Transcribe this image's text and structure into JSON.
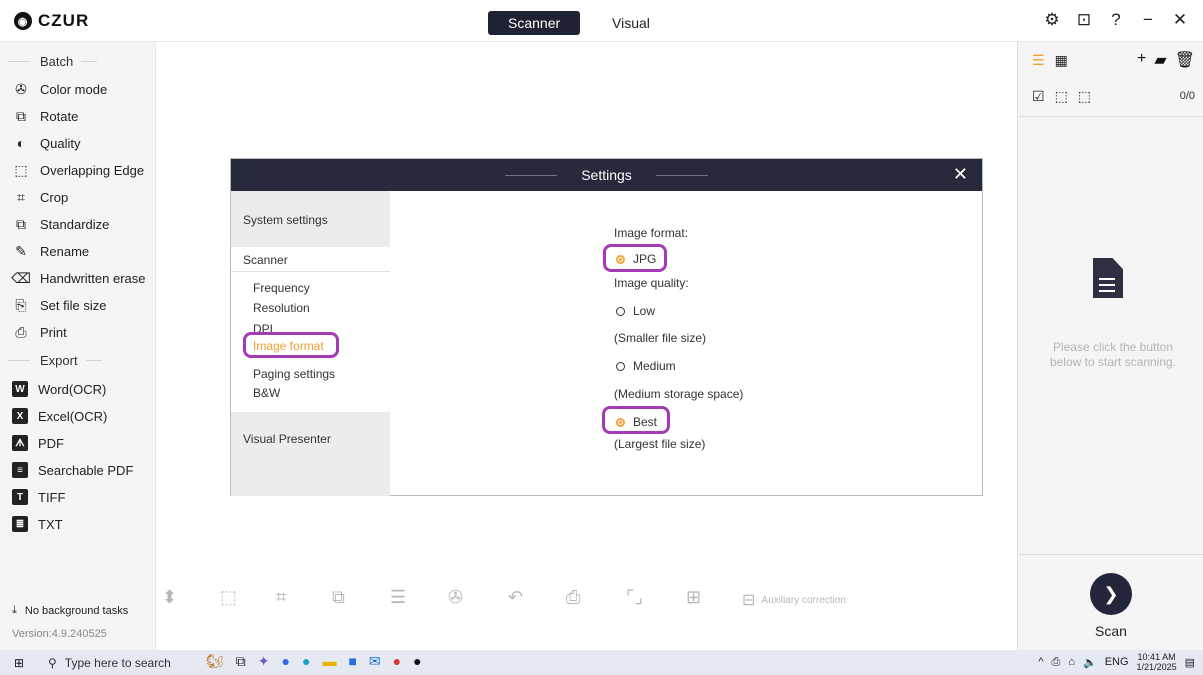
{
  "app": {
    "logo": "CZUR",
    "tabs": [
      {
        "label": "Scanner",
        "active": true
      },
      {
        "label": "Visual",
        "active": false
      }
    ]
  },
  "sidebar": {
    "batch_header": "Batch",
    "batch_items": [
      {
        "label": "Color mode",
        "icon": "color-mode-icon"
      },
      {
        "label": "Rotate",
        "icon": "rotate-icon"
      },
      {
        "label": "Quality",
        "icon": "quality-icon"
      },
      {
        "label": "Overlapping Edge",
        "icon": "overlapping-edge-icon"
      },
      {
        "label": "Crop",
        "icon": "crop-icon"
      },
      {
        "label": "Standardize",
        "icon": "standardize-icon"
      },
      {
        "label": "Rename",
        "icon": "rename-icon"
      },
      {
        "label": "Handwritten erase",
        "icon": "handwritten-erase-icon"
      },
      {
        "label": "Set file size",
        "icon": "set-file-size-icon"
      },
      {
        "label": "Print",
        "icon": "print-icon"
      }
    ],
    "export_header": "Export",
    "export_items": [
      {
        "label": "Word(OCR)",
        "icon": "word-icon"
      },
      {
        "label": "Excel(OCR)",
        "icon": "excel-icon"
      },
      {
        "label": "PDF",
        "icon": "pdf-icon"
      },
      {
        "label": "Searchable PDF",
        "icon": "searchable-pdf-icon"
      },
      {
        "label": "TIFF",
        "icon": "tiff-icon"
      },
      {
        "label": "TXT",
        "icon": "txt-icon"
      }
    ],
    "background_tasks": "No background tasks",
    "version": "Version:4.9.240525"
  },
  "settings": {
    "title": "Settings",
    "nav": {
      "system": "System settings",
      "scanner": "Scanner",
      "scanner_items": [
        "Frequency",
        "Resolution",
        "DPI",
        "Image format",
        "Paging settings",
        "B&W"
      ],
      "active_item": "Image format",
      "visual": "Visual Presenter"
    },
    "image_format_label": "Image format:",
    "image_format_value": "JPG",
    "image_quality_label": "Image quality:",
    "quality_options": [
      {
        "label": "Low",
        "note": "(Smaller file size)",
        "selected": false
      },
      {
        "label": "Medium",
        "note": "(Medium storage space)",
        "selected": false
      },
      {
        "label": "Best",
        "note": "(Largest file size)",
        "selected": true
      }
    ]
  },
  "right_panel": {
    "count": "0/0",
    "empty_message": "Please click the button below to start scanning.",
    "scan_label": "Scan"
  },
  "toolbar": {
    "auxiliary_label": "Auxiliary correction"
  },
  "taskbar": {
    "search_placeholder": "Type here to search",
    "language": "ENG",
    "time": "10:41 AM",
    "date": "1/21/2025"
  },
  "colors": {
    "dark_header": "#262a3b",
    "accent_orange": "#f0a030",
    "highlight_purple": "#a43ab4"
  }
}
